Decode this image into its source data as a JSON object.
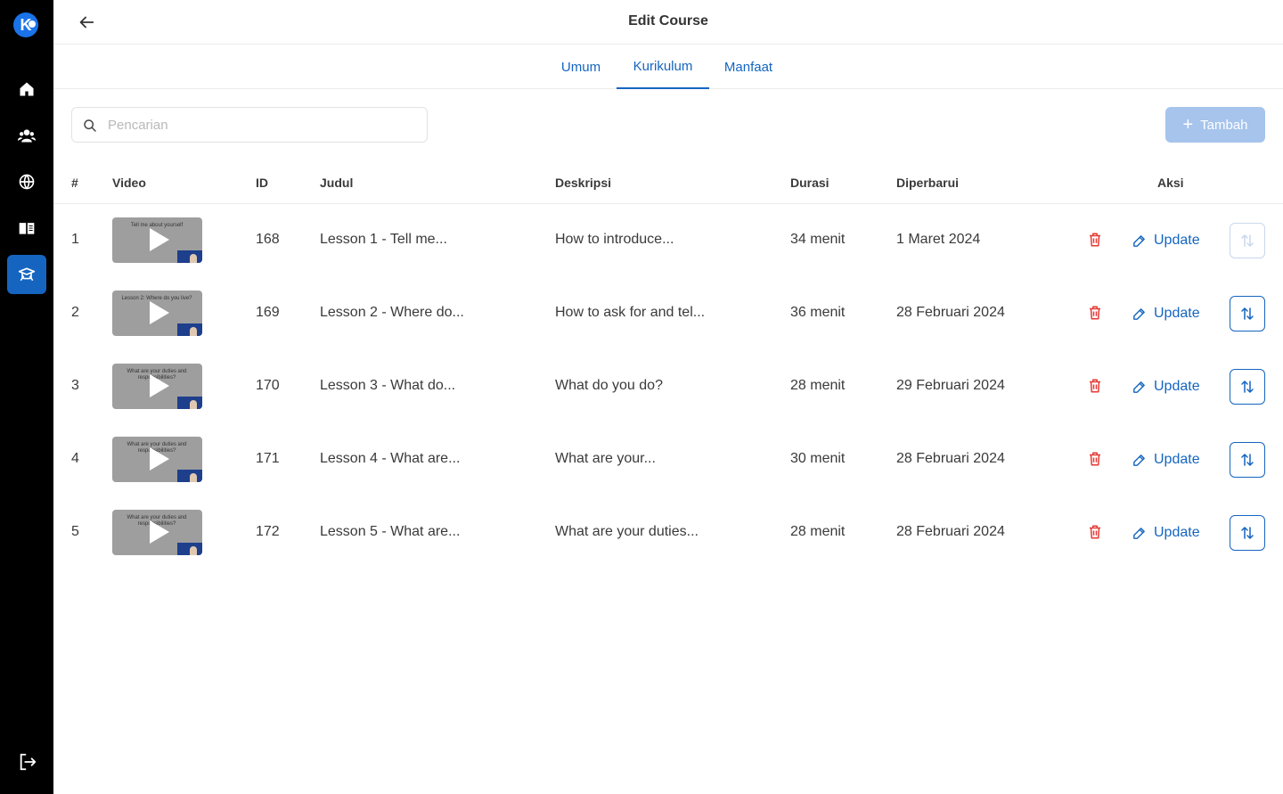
{
  "header": {
    "title": "Edit Course"
  },
  "tabs": [
    {
      "label": "Umum"
    },
    {
      "label": "Kurikulum"
    },
    {
      "label": "Manfaat"
    }
  ],
  "search": {
    "placeholder": "Pencarian",
    "value": ""
  },
  "add_button": {
    "label": "Tambah"
  },
  "table": {
    "columns": [
      "#",
      "Video",
      "ID",
      "Judul",
      "Deskripsi",
      "Durasi",
      "Diperbarui",
      "Aksi"
    ],
    "rows": [
      {
        "no": "1",
        "id": "168",
        "title": "Lesson 1 - Tell me...",
        "description": "How to introduce...",
        "duration": "34 menit",
        "updated": "1 Maret 2024",
        "thumb_text": "Tell me about yourself",
        "sort_enabled": false
      },
      {
        "no": "2",
        "id": "169",
        "title": "Lesson 2 - Where do...",
        "description": "How to ask for and tel...",
        "duration": "36 menit",
        "updated": "28 Februari 2024",
        "thumb_text": "Lesson 2: Where do you live?",
        "sort_enabled": true
      },
      {
        "no": "3",
        "id": "170",
        "title": "Lesson 3 - What do...",
        "description": "What do you do?",
        "duration": "28 menit",
        "updated": "29 Februari 2024",
        "thumb_text": "What are your duties and responsibilities?",
        "sort_enabled": true
      },
      {
        "no": "4",
        "id": "171",
        "title": "Lesson 4 - What are...",
        "description": "What are your...",
        "duration": "30 menit",
        "updated": "28 Februari 2024",
        "thumb_text": "What are your duties and responsibilities?",
        "sort_enabled": true
      },
      {
        "no": "5",
        "id": "172",
        "title": "Lesson 5 - What are...",
        "description": "What are your duties...",
        "duration": "28 menit",
        "updated": "28 Februari 2024",
        "thumb_text": "What are your duties and responsibilities?",
        "sort_enabled": true
      }
    ],
    "update_label": "Update"
  },
  "sidebar": {
    "logo_letter": "K",
    "items": [
      {
        "icon": "home-icon"
      },
      {
        "icon": "users-icon"
      },
      {
        "icon": "globe-icon"
      },
      {
        "icon": "book-icon"
      },
      {
        "icon": "graduation-icon",
        "active": true
      }
    ]
  },
  "colors": {
    "accent": "#1565c0",
    "danger": "#e53935",
    "sidebar": "#000000",
    "add_button": "#a6c4ec"
  }
}
